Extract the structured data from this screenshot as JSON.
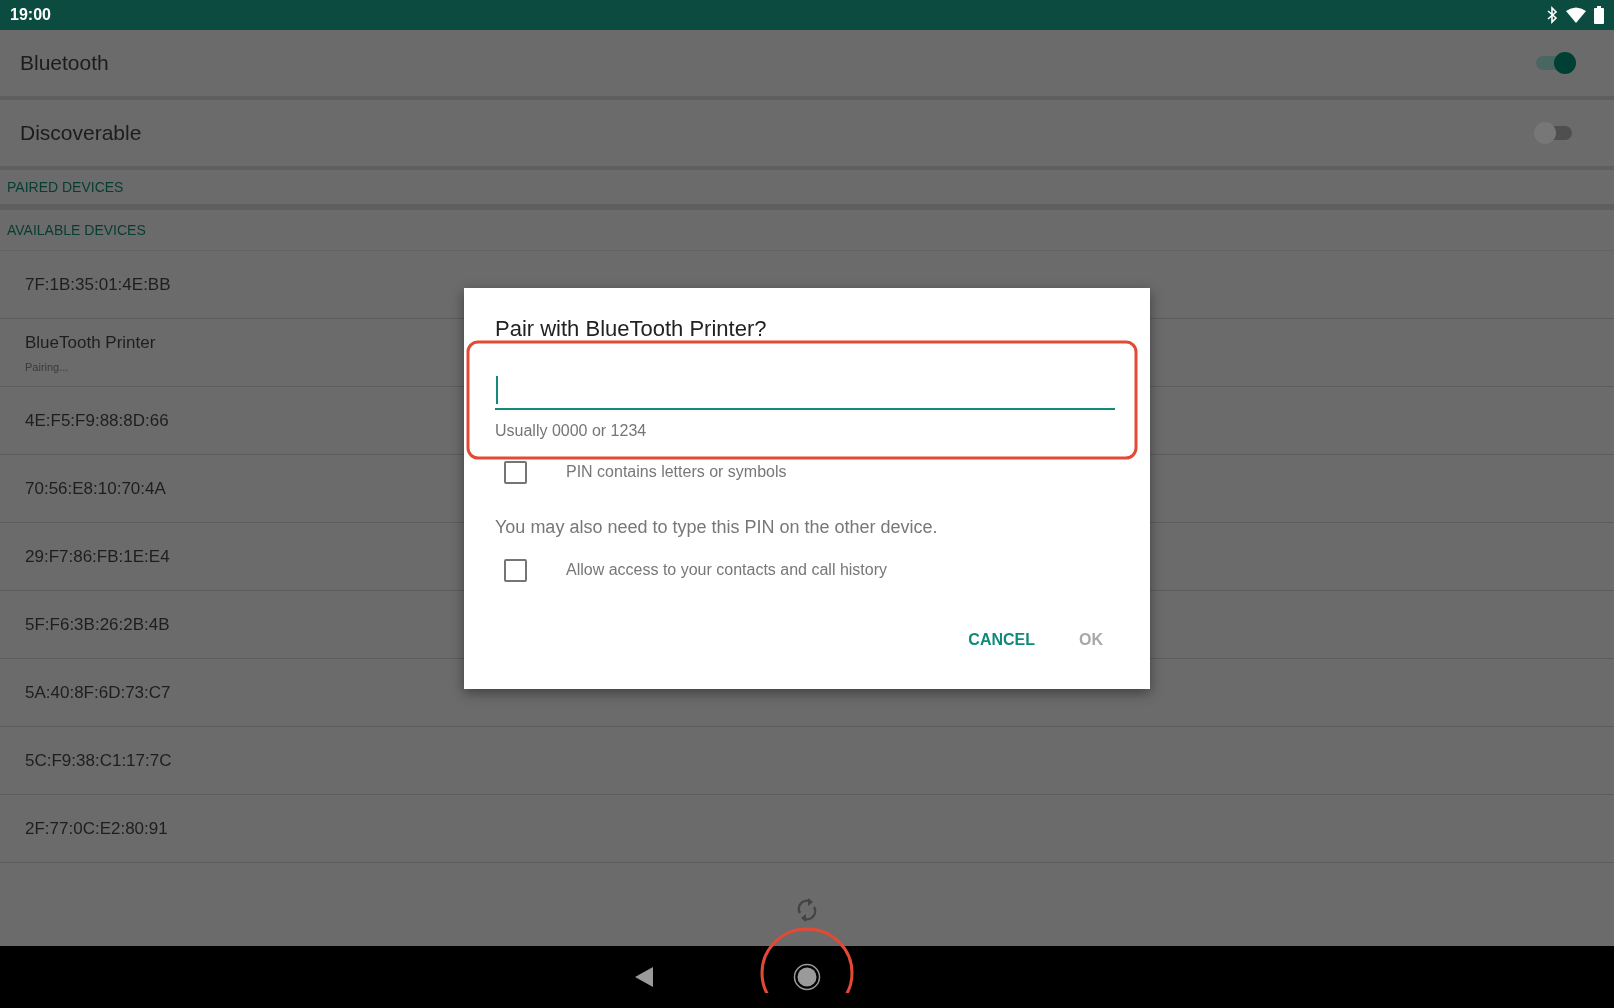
{
  "status_bar": {
    "time": "19:00"
  },
  "settings": [
    {
      "label": "Bluetooth",
      "on": true
    },
    {
      "label": "Discoverable",
      "on": false
    }
  ],
  "paired_header": "PAIRED DEVICES",
  "available_header": "AVAILABLE DEVICES",
  "devices": [
    {
      "name": "7F:1B:35:01:4E:BB"
    },
    {
      "name": "BlueTooth Printer",
      "status": "Pairing..."
    },
    {
      "name": "4E:F5:F9:88:8D:66"
    },
    {
      "name": "70:56:E8:10:70:4A"
    },
    {
      "name": "29:F7:86:FB:1E:E4"
    },
    {
      "name": "5F:F6:3B:26:2B:4B"
    },
    {
      "name": "5A:40:8F:6D:73:C7"
    },
    {
      "name": "5C:F9:38:C1:17:7C"
    },
    {
      "name": "2F:77:0C:E2:80:91"
    }
  ],
  "dialog": {
    "title": "Pair with BlueTooth Printer?",
    "pin_field": {
      "helper": "Usually 0000 or 1234"
    },
    "items": [
      {
        "kind": "checkbox",
        "label": "PIN contains letters or symbols",
        "checked": false
      },
      {
        "kind": "note",
        "text": "You may also need to type this PIN on the other device."
      },
      {
        "kind": "checkbox",
        "label": "Allow access to your contacts and call history",
        "checked": false
      }
    ],
    "buttons": [
      {
        "label": "CANCEL",
        "disabled": false
      },
      {
        "label": "OK",
        "disabled": true
      }
    ]
  }
}
